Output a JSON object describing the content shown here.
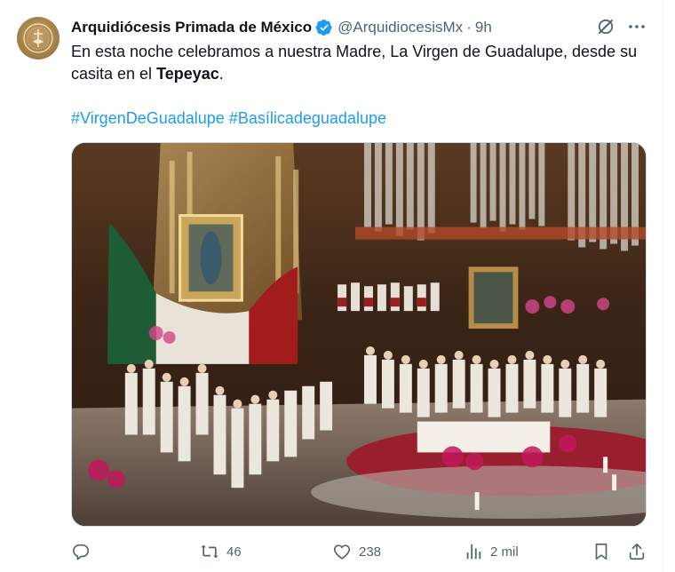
{
  "tweet": {
    "author_name": "Arquidiócesis Primada de México",
    "handle": "@ArquidiocesisMx",
    "separator": "·",
    "time": "9h",
    "text_part1": "En esta noche celebramos a nuestra Madre, La Virgen de Guadalupe, desde su casita en el ",
    "text_bold": "Tepeyac",
    "text_part2": ".",
    "hashtag1": "#VirgenDeGuadalupe",
    "hashtag2": "#Basílicadeguadalupe"
  },
  "actions": {
    "reply_count": "",
    "retweet_count": "46",
    "like_count": "238",
    "views_count": "2 mil"
  },
  "icons": {
    "verified": "verified-badge-icon",
    "grok": "grok-icon",
    "more": "more-icon",
    "reply": "reply-icon",
    "retweet": "retweet-icon",
    "like": "heart-icon",
    "views": "views-icon",
    "bookmark": "bookmark-icon",
    "share": "share-icon"
  },
  "colors": {
    "text": "#0f1419",
    "secondary": "#536471",
    "link": "#1d9bf0",
    "verified": "#1d9bf0"
  }
}
